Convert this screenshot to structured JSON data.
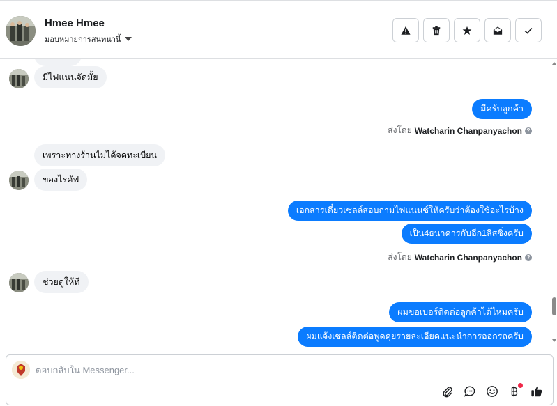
{
  "header": {
    "name": "Hmee Hmee",
    "assign_label": "มอบหมายการสนทนานี้",
    "actions": [
      {
        "icon": "warning-icon",
        "name": "report-button"
      },
      {
        "icon": "trash-icon",
        "name": "delete-button"
      },
      {
        "icon": "star-icon",
        "name": "star-button"
      },
      {
        "icon": "envelope-open-icon",
        "name": "mark-unread-button"
      },
      {
        "icon": "check-icon",
        "name": "mark-done-button"
      }
    ]
  },
  "messages": {
    "m1": "มีไฟแนนจัดมั้ย",
    "m2": "มีครับลูกค้า",
    "sent1_prefix": "ส่งโดย",
    "sent1_name": "Watcharin Chanpanyachon",
    "m3": "เพราะทางร้านไม่ได้จดทะเบียน",
    "m4": "ของไรคัฟ",
    "m5": "เอกสารเดี๋ยวเซลล์สอบถามไฟแนนซ์ให้ครับว่าต้องใช้อะไรบ้าง",
    "m6": "เป็น4ธนาคารกับอีก1ลิสซิ่งครับ",
    "sent2_prefix": "ส่งโดย",
    "sent2_name": "Watcharin Chanpanyachon",
    "m7": "ช่วยดูให้ที",
    "m8": "ผมขอเบอร์ติดต่อลูกค้าได้ไหมครับ",
    "m9": "ผมแจ้งเซลล์ติดต่อพูดคุยรายละเอียดแนะนำการออกรถครับ"
  },
  "composer": {
    "placeholder": "ตอบกลับใน Messenger...",
    "tools": [
      "paperclip-icon",
      "chat-bubble-icon",
      "emoji-icon",
      "baht-icon",
      "thumbs-up-icon"
    ]
  },
  "colors": {
    "outgoing": "#0b7cff",
    "incoming": "#f0f2f5",
    "border": "#dddfe2"
  }
}
